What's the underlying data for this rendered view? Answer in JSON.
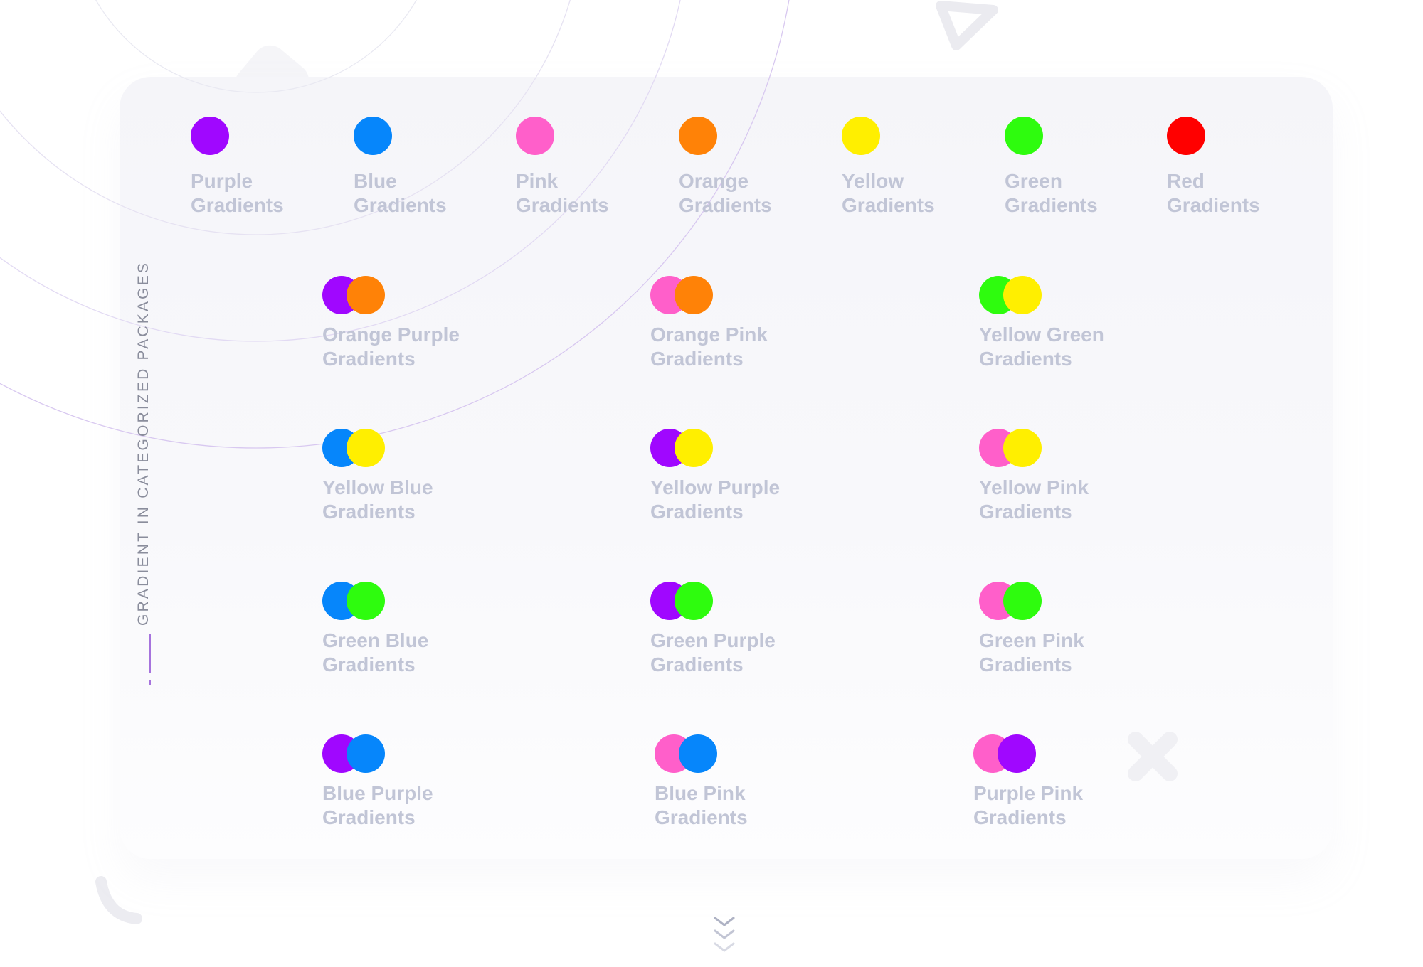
{
  "side_title": "GRADIENT IN CATEGORIZED PACKAGES",
  "colors": {
    "purple": "#a007ff",
    "blue": "#0686fb",
    "pink": "#ff5fca",
    "orange": "#ff8207",
    "yellow": "#ffef00",
    "green": "#2efc0e",
    "red": "#ff0000",
    "label": "#c1c5d6",
    "accent": "#a673dd"
  },
  "single_gradients": [
    {
      "line1": "Purple",
      "line2": "Gradients",
      "color": "#a007ff"
    },
    {
      "line1": "Blue",
      "line2": "Gradients",
      "color": "#0686fb"
    },
    {
      "line1": "Pink",
      "line2": "Gradients",
      "color": "#ff5fca"
    },
    {
      "line1": "Orange",
      "line2": "Gradients",
      "color": "#ff8207"
    },
    {
      "line1": "Yellow",
      "line2": "Gradients",
      "color": "#ffef00"
    },
    {
      "line1": "Green",
      "line2": "Gradients",
      "color": "#2efc0e"
    },
    {
      "line1": "Red",
      "line2": "Gradients",
      "color": "#ff0000"
    }
  ],
  "combo_gradients": [
    {
      "line1": "Orange Purple",
      "line2": "Gradients",
      "colors": [
        "#a007ff",
        "#ff8207"
      ]
    },
    {
      "line1": "Orange Pink",
      "line2": "Gradients",
      "colors": [
        "#ff5fca",
        "#ff8207"
      ]
    },
    {
      "line1": "Yellow Green",
      "line2": "Gradients",
      "colors": [
        "#2efc0e",
        "#ffef00"
      ]
    },
    {
      "line1": "Yellow Blue",
      "line2": "Gradients",
      "colors": [
        "#0686fb",
        "#ffef00"
      ]
    },
    {
      "line1": "Yellow Purple",
      "line2": "Gradients",
      "colors": [
        "#a007ff",
        "#ffef00"
      ]
    },
    {
      "line1": "Yellow Pink",
      "line2": "Gradients",
      "colors": [
        "#ff5fca",
        "#ffef00"
      ]
    },
    {
      "line1": "Green Blue",
      "line2": "Gradients",
      "colors": [
        "#0686fb",
        "#2efc0e"
      ]
    },
    {
      "line1": "Green Purple",
      "line2": "Gradients",
      "colors": [
        "#a007ff",
        "#2efc0e"
      ]
    },
    {
      "line1": "Green Pink",
      "line2": "Gradients",
      "colors": [
        "#ff5fca",
        "#2efc0e"
      ]
    },
    {
      "line1": "Blue Purple",
      "line2": "Gradients",
      "colors": [
        "#a007ff",
        "#0686fb"
      ]
    },
    {
      "line1": "Blue Pink",
      "line2": "Gradients",
      "colors": [
        "#ff5fca",
        "#0686fb"
      ]
    },
    {
      "line1": "Purple Pink",
      "line2": "Gradients",
      "colors": [
        "#ff5fca",
        "#a007ff"
      ]
    }
  ],
  "decorations": {
    "triangle_icon": "triangle-outline-icon",
    "cross_icon": "cross-icon",
    "arc_icon": "arc-icon",
    "scroll_icon": "chevrons-down-icon"
  }
}
